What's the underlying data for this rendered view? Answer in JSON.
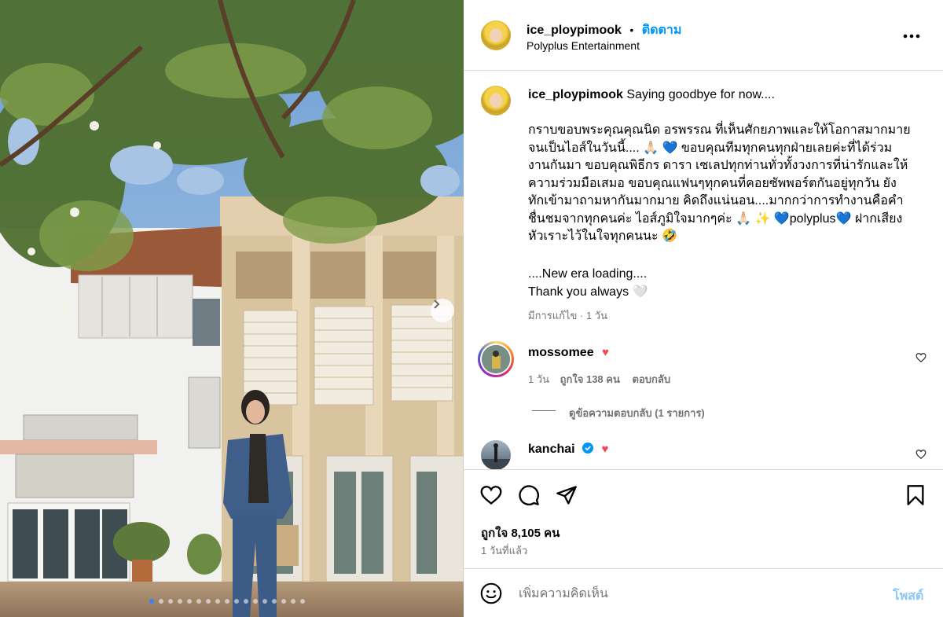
{
  "header": {
    "username": "ice_ploypimook",
    "separator": "•",
    "follow_label": "ติดตาม",
    "subtitle": "Polyplus Entertainment",
    "more_icon": "more-horizontal-icon"
  },
  "caption": {
    "username": "ice_ploypimook",
    "headline": "Saying goodbye for now....",
    "lines": [
      "กราบขอบพระคุณคุณนิด อรพรรณ ที่เห็นศักยภาพและให้โอกาสมากมาย",
      "จนเป็นไอส์ในวันนี้.... 🙏🏻 💙  ขอบคุณทีมทุกคนทุกฝ่ายเลยค่ะที่ได้ร่วม",
      "งานกันมา ขอบคุณพิธีกร ดารา เซเลปทุกท่านทั่วทั้งวงการที่น่ารักและให้",
      "ความร่วมมือเสมอ ขอบคุณแฟนๆทุกคนที่คอยซัพพอร์ตกันอยู่ทุกวัน ยัง",
      "ทักเข้ามาถามหากันมากมาย คิดถึงแน่นอน....มากกว่าการทำงานคือคำ",
      "ชื่นชมจากทุกคนค่ะ ไอส์ภูมิใจมากๆค่ะ 🙏🏻 ✨ 💙polyplus💙 ฝากเสียง",
      "หัวเราะไว้ในใจทุกคนนะ 🤣"
    ],
    "lines2": [
      "....New era loading....",
      "Thank you always 🤍"
    ],
    "meta": "มีการแก้ไข · 1 วัน"
  },
  "comments": [
    {
      "username": "mossomee",
      "emoji": "♥",
      "time": "1 วัน",
      "likes": "ถูกใจ 138 คน",
      "reply_label": "ตอบกลับ",
      "view_replies": "ดูข้อความตอบกลับ (1 รายการ)"
    },
    {
      "username": "kanchai",
      "emoji": "♥",
      "verified": true
    }
  ],
  "actions": {
    "like_icon": "heart-icon",
    "comment_icon": "comment-icon",
    "share_icon": "share-icon",
    "save_icon": "bookmark-icon"
  },
  "stats": {
    "likes": "ถูกใจ 8,105 คน",
    "posted": "1 วันที่แล้ว"
  },
  "composer": {
    "emoji_icon": "smiley-icon",
    "placeholder": "เพิ่มความคิดเห็น",
    "post_label": "โพสต์"
  },
  "carousel": {
    "total_slides": 17,
    "active_index": 0,
    "next_icon": "chevron-right-icon"
  },
  "colors": {
    "accent": "#0095f6",
    "muted": "#737373",
    "heart": "#ed4956",
    "post_disabled": "#8ec8f6"
  }
}
